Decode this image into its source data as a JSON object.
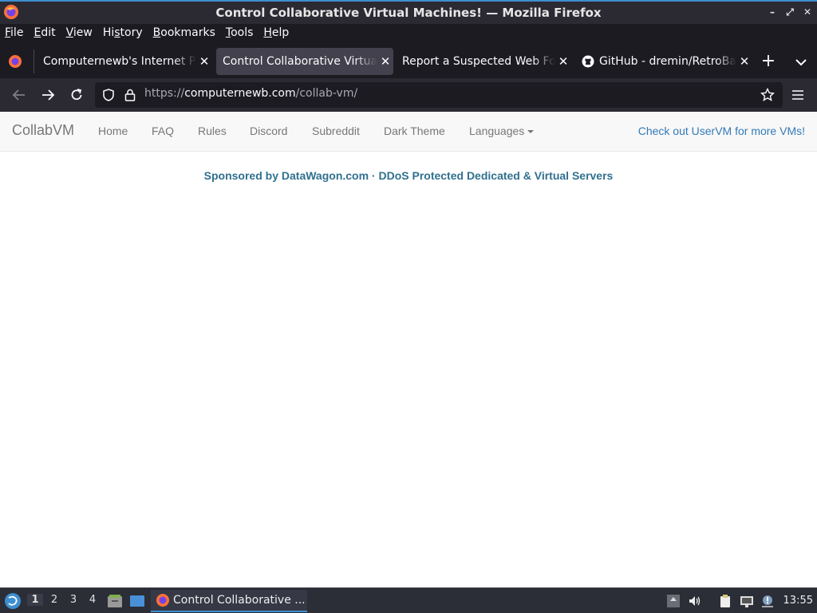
{
  "window": {
    "title": "Control Collaborative Virtual Machines! — Mozilla Firefox",
    "min_glyph": "–",
    "max_glyph": "⤢",
    "close_glyph": "✕"
  },
  "menubar": {
    "items": [
      {
        "u": "F",
        "rest": "ile"
      },
      {
        "u": "E",
        "rest": "dit"
      },
      {
        "u": "V",
        "rest": "iew"
      },
      {
        "pre": "Hi",
        "u": "s",
        "rest": "tory"
      },
      {
        "u": "B",
        "rest": "ookmarks"
      },
      {
        "u": "T",
        "rest": "ools"
      },
      {
        "u": "H",
        "rest": "elp"
      }
    ]
  },
  "tabs": [
    {
      "label": "Computernewb's Internet Pub",
      "close": "✕"
    },
    {
      "label": "Control Collaborative Virtual Machines!",
      "close": "✕"
    },
    {
      "label": "Report a Suspected Web Forgery",
      "close": "✕"
    },
    {
      "label": "GitHub - dremin/RetroBar",
      "close": "✕"
    }
  ],
  "new_tab_glyph": "+",
  "urlbar": {
    "scheme": "https://",
    "host": "computernewb.com",
    "path": "/collab-vm/"
  },
  "site": {
    "brand": "CollabVM",
    "nav": [
      "Home",
      "FAQ",
      "Rules",
      "Discord",
      "Subreddit",
      "Dark Theme"
    ],
    "languages": "Languages",
    "uservm_link": "Check out UserVM for more VMs!",
    "sponsor": "Sponsored by DataWagon.com · DDoS Protected Dedicated & Virtual Servers"
  },
  "taskbar": {
    "workspaces": [
      "1",
      "2",
      "3",
      "4"
    ],
    "task_label": "Control Collaborative ...",
    "clock": "13:55"
  },
  "colors": {
    "accent": "#3e8ed0",
    "link": "#337ab7",
    "sponsor": "#31708f"
  }
}
